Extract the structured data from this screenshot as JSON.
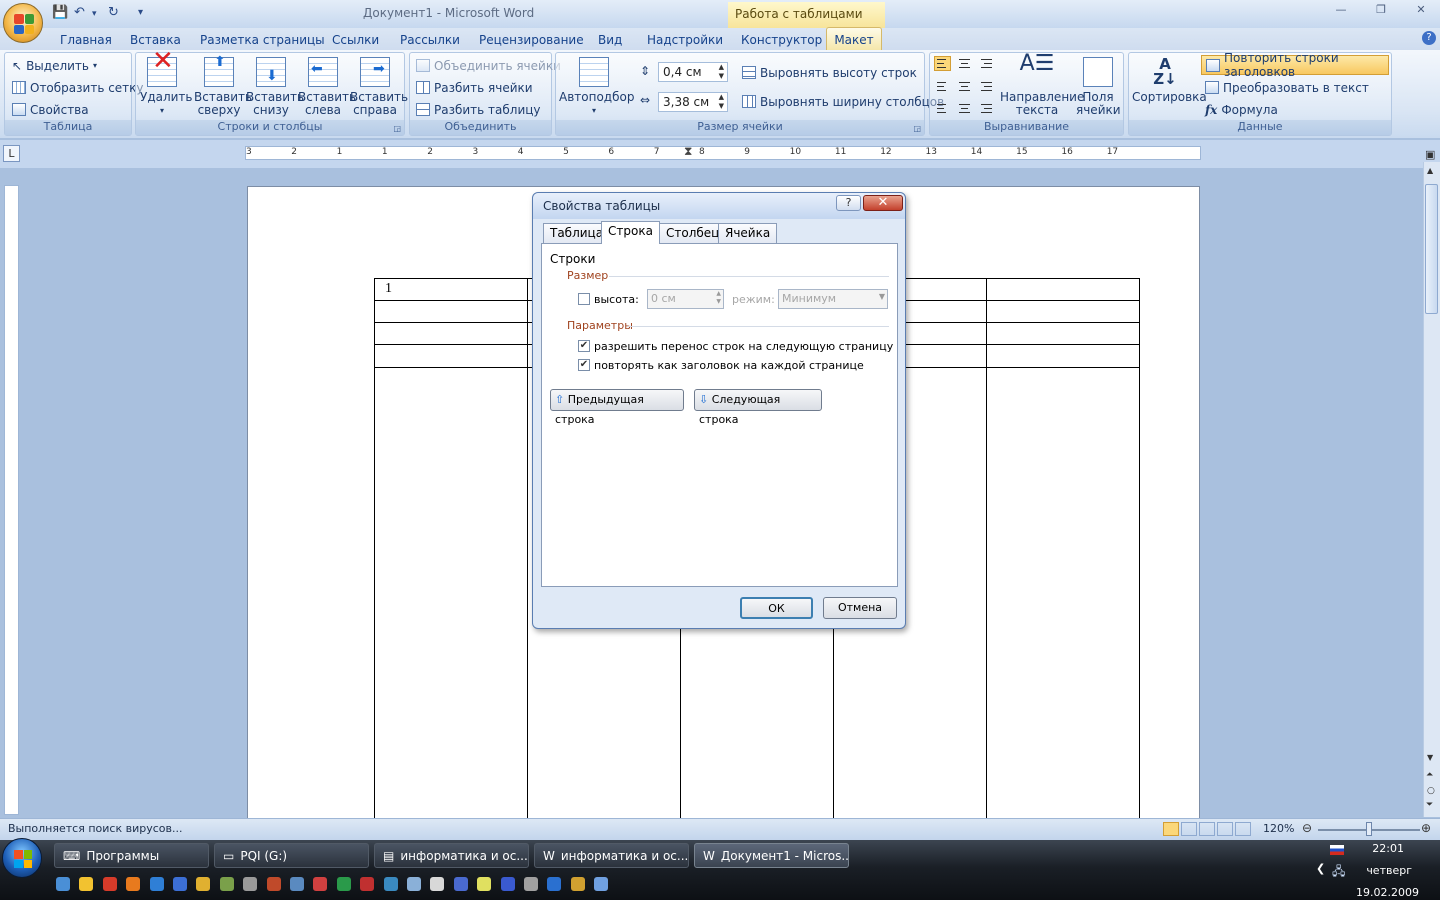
{
  "window": {
    "title": "Документ1 - Microsoft Word",
    "context_group": "Работа с таблицами"
  },
  "tabs": [
    "Главная",
    "Вставка",
    "Разметка страницы",
    "Ссылки",
    "Рассылки",
    "Рецензирование",
    "Вид",
    "Надстройки",
    "Конструктор",
    "Макет"
  ],
  "active_tab": "Макет",
  "ribbon": {
    "table": {
      "label": "Таблица",
      "select": "Выделить",
      "show_grid": "Отобразить сетку",
      "properties": "Свойства"
    },
    "rows_cols": {
      "label": "Строки и столбцы",
      "delete": "Удалить",
      "insert_above_1": "Вставить",
      "insert_above_2": "сверху",
      "insert_below_1": "Вставить",
      "insert_below_2": "снизу",
      "insert_left_1": "Вставить",
      "insert_left_2": "слева",
      "insert_right_1": "Вставить",
      "insert_right_2": "справа"
    },
    "merge": {
      "label": "Объединить",
      "merge_cells": "Объединить ячейки",
      "split_cells": "Разбить ячейки",
      "split_table": "Разбить таблицу"
    },
    "cell_size": {
      "label": "Размер ячейки",
      "autofit": "Автоподбор",
      "height": "0,4 см",
      "width": "3,38 см",
      "distribute_rows": "Выровнять высоту строк",
      "distribute_cols": "Выровнять ширину столбцов"
    },
    "alignment": {
      "label": "Выравнивание",
      "text_direction_1": "Направление",
      "text_direction_2": "текста",
      "margins_1": "Поля",
      "margins_2": "ячейки"
    },
    "data": {
      "label": "Данные",
      "sort": "Сортировка",
      "repeat_headers": "Повторить строки заголовков",
      "convert": "Преобразовать в текст",
      "formula": "Формула"
    }
  },
  "ruler": {
    "left_numbers": [
      "3",
      "2",
      "1",
      "1",
      "2",
      "3",
      "4",
      "5",
      "6",
      "7",
      "8",
      "9",
      "10",
      "11",
      "12",
      "13",
      "14",
      "15",
      "16",
      "17"
    ]
  },
  "document": {
    "first_cell": "1"
  },
  "dialog": {
    "title": "Свойства таблицы",
    "help": "?",
    "close": "✕",
    "tabs": [
      "Таблица",
      "Строка",
      "Столбец",
      "Ячейка"
    ],
    "active_tab": "Строка",
    "rows_heading": "Строки",
    "size_section": "Размер",
    "height_label": "высота:",
    "height_checked": false,
    "height_value": "0 см",
    "mode_label": "режим:",
    "mode_value": "Минимум",
    "params_section": "Параметры",
    "allow_break": "разрешить перенос строк на следующую страницу",
    "allow_break_checked": true,
    "repeat_header": "повторять как заголовок на каждой странице",
    "repeat_header_checked": true,
    "prev_row": "Предыдущая строка",
    "next_row": "Следующая строка",
    "ok": "ОК",
    "cancel": "Отмена"
  },
  "status": {
    "text": "Выполняется поиск вирусов...",
    "zoom": "120%"
  },
  "taskbar": {
    "items": [
      "Программы",
      "PQI (G:)",
      "информатика и ос...",
      "информатика и ос...",
      "Документ1 - Micros..."
    ],
    "active_index": 4,
    "time": "22:01",
    "day": "четверг",
    "date": "19.02.2009"
  },
  "colors": {
    "accent": "#15428b",
    "context_tab": "#f7e49a",
    "close_button": "#c3402c"
  }
}
